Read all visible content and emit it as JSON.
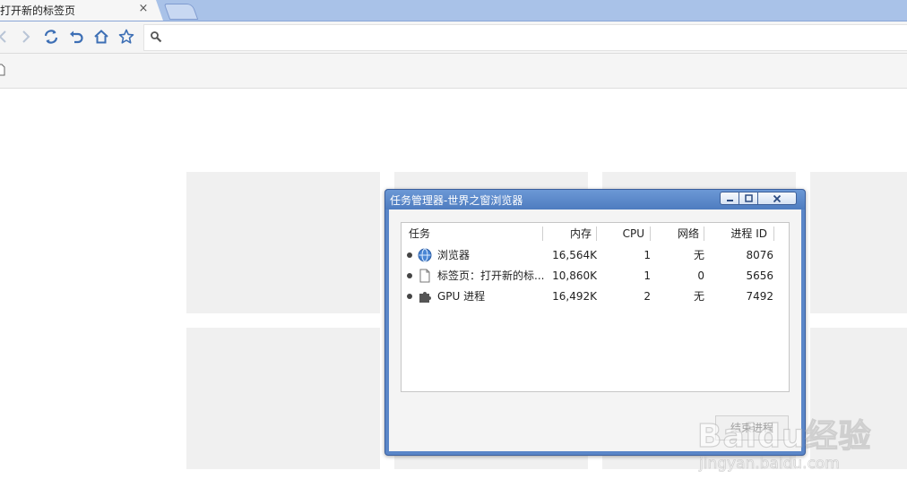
{
  "browser": {
    "tab": {
      "title": "打开新的标签页",
      "close_glyph": "×"
    },
    "toolbar": {
      "icons": [
        "back-icon",
        "forward-icon",
        "refresh-icon",
        "undo-icon",
        "home-icon",
        "star-icon"
      ],
      "address_placeholder": ""
    }
  },
  "task_manager": {
    "title": "任务管理器-世界之窗浏览器",
    "columns": [
      "任务",
      "内存",
      "CPU",
      "网络",
      "进程 ID"
    ],
    "rows": [
      {
        "icon": "globe-icon",
        "task": "浏览器",
        "memory": "16,564K",
        "cpu": "1",
        "network": "无",
        "pid": "8076"
      },
      {
        "icon": "page-icon",
        "task": "标签页：打开新的标...",
        "memory": "10,860K",
        "cpu": "1",
        "network": "0",
        "pid": "5656"
      },
      {
        "icon": "puzzle-icon",
        "task": "GPU 进程",
        "memory": "16,492K",
        "cpu": "2",
        "network": "无",
        "pid": "7492"
      }
    ],
    "end_button_label": "结束进程"
  },
  "watermark": {
    "main": "Baidu经验",
    "sub": "jingyan.baidu.com"
  },
  "colors": {
    "accent": "#5a86c8",
    "tab_strip": "#a9c2e8",
    "icon": "#3d6fb5"
  }
}
